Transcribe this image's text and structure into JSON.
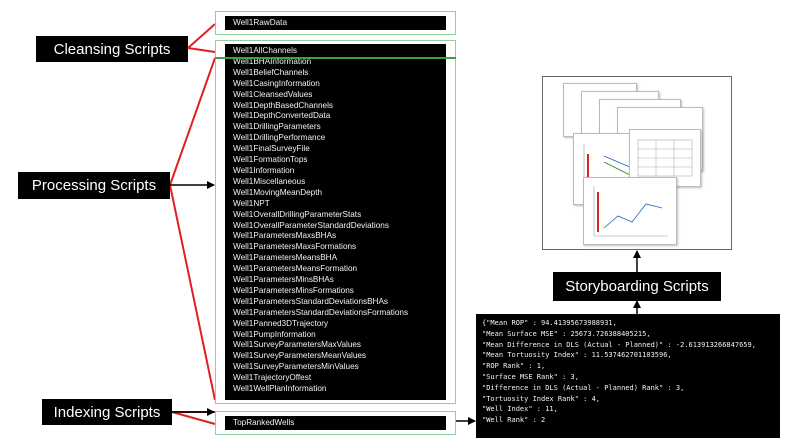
{
  "labels": {
    "cleansing": "Cleansing Scripts",
    "processing": "Processing Scripts",
    "indexing": "Indexing Scripts",
    "storyboarding": "Storyboarding Scripts"
  },
  "raw_data": "Well1RawData",
  "processed_items": [
    "Well1AllChannels",
    "Well1BHAInformation",
    "Well1BeliefChannels",
    "Well1CasingInformation",
    "Well1CleansedValues",
    "Well1DepthBasedChannels",
    "Well1DepthConvertedData",
    "Well1DrillingParameters",
    "Well1DrillingPerformance",
    "Well1FinalSurveyFile",
    "Well1FormationTops",
    "Well1Information",
    "Well1Miscellaneous",
    "Well1MovingMeanDepth",
    "Well1NPT",
    "Well1OverallDrillingParameterStats",
    "Well1OverallParameterStandardDeviations",
    "Well1ParametersMaxsBHAs",
    "Well1ParametersMaxsFormations",
    "Well1ParametersMeansBHA",
    "Well1ParametersMeansFormation",
    "Well1ParametersMinsBHAs",
    "Well1ParametersMinsFormations",
    "Well1ParametersStandardDeviationsBHAs",
    "Well1ParametersStandardDeviationsFormations",
    "Well1Panned3DTrajectory",
    "Well1PumpInformation",
    "Well1SurveyParametersMaxValues",
    "Well1SurveyParametersMeanValues",
    "Well1SurveyParametersMinValues",
    "Well1TrajectoryOffest",
    "Well1WellPlanInformation"
  ],
  "ranked_wells": "TopRankedWells",
  "json_lines": [
    "{\"Mean ROP\" : 94.41395673988931,",
    "\"Mean Surface MSE\" : 25673.726388405215,",
    "\"Mean Difference in DLS (Actual - Planned)\" : -2.613913266847659,",
    "\"Mean Tortuosity Index\" : 11.537462701103596,",
    "\"ROP Rank\" : 1,",
    "\"Surface MSE Rank\" : 3,",
    "\"Difference in DLS (Actual - Planned) Rank\" : 3,",
    "\"Tortuosity Index Rank\" : 4,",
    "\"Well Index\" : 11,",
    "\"Well Rank\" : 2"
  ],
  "colors": {
    "connector_red": "#e02020",
    "connector_black": "#000000",
    "frame_green": "#8fd19e",
    "panel_black": "#000000",
    "text_white": "#ffffff"
  }
}
